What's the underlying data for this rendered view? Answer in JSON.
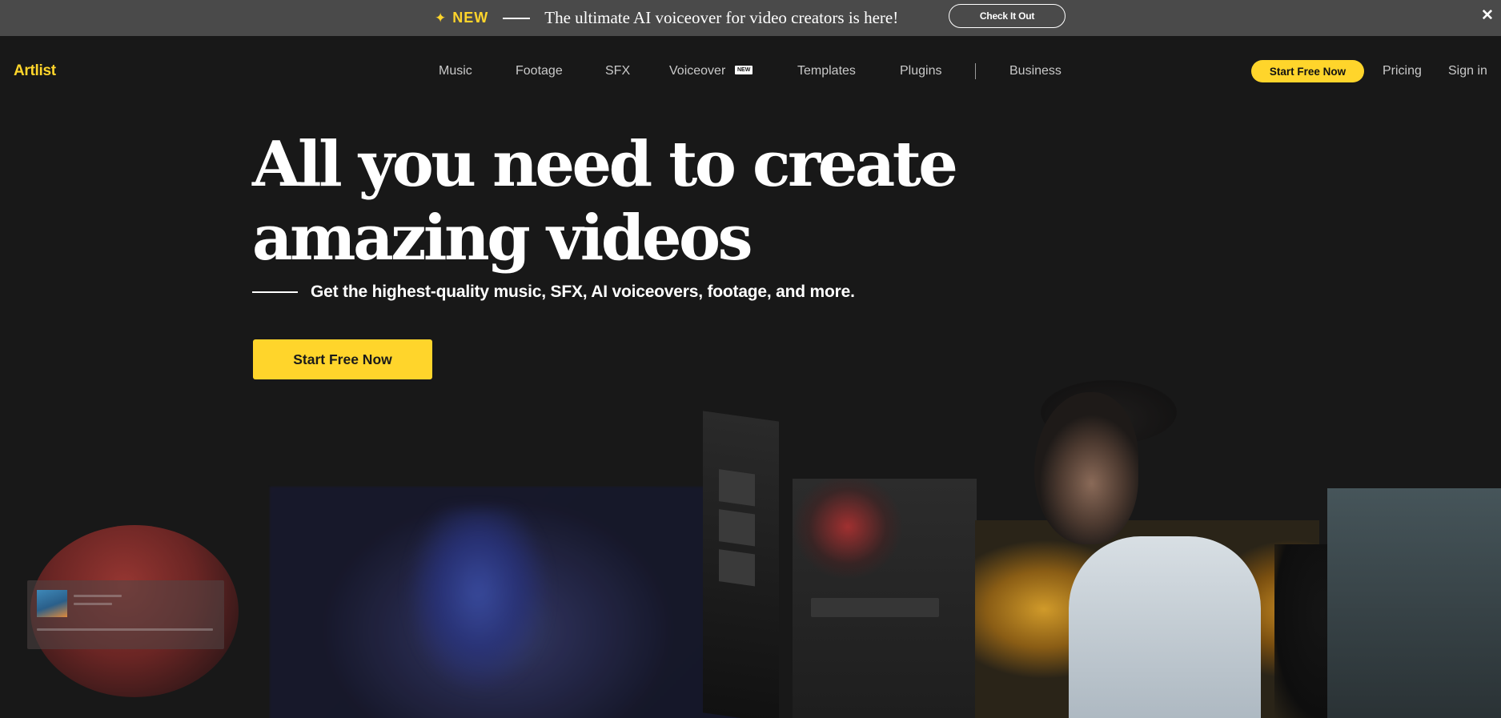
{
  "announcement": {
    "badge": "NEW",
    "sparkle_icon": "sparkle-icon",
    "text": "The ultimate AI voiceover for video creators is here!",
    "button_label": "Check It Out",
    "close_icon": "close-icon"
  },
  "nav": {
    "logo": "Artlist",
    "links": [
      "Music",
      "Footage",
      "SFX",
      "Voiceover",
      "Templates",
      "Plugins",
      "Business"
    ],
    "voiceover_badge": "NEW",
    "cta_label": "Start Free Now",
    "pricing": "Pricing",
    "sign_in": "Sign in"
  },
  "hero": {
    "title_line1": "All you need to create",
    "title_line2": "amazing videos",
    "subtitle": "Get the highest-quality music, SFX, AI voiceovers, footage, and more.",
    "cta_label": "Start Free Now"
  },
  "colors": {
    "accent": "#ffd52b",
    "background": "#181818",
    "announcement_bg": "#4a4a4a"
  }
}
